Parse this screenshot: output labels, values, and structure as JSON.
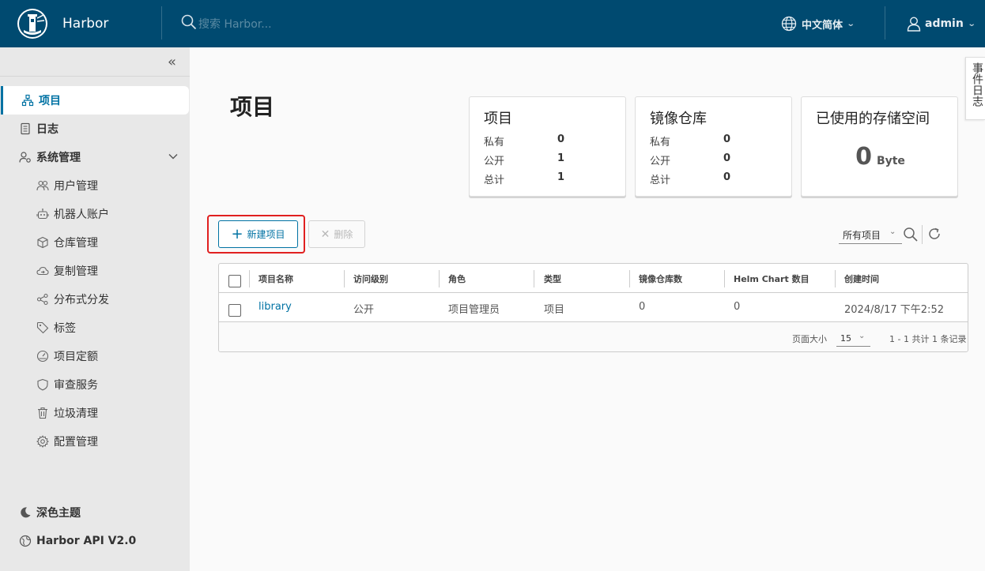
{
  "header": {
    "app_name": "Harbor",
    "search_placeholder": "搜索 Harbor...",
    "language": "中文简体",
    "user": "admin"
  },
  "sidebar": {
    "items": [
      {
        "label": "项目",
        "icon": "projects-icon",
        "active": true
      },
      {
        "label": "日志",
        "icon": "logs-icon"
      },
      {
        "label": "系统管理",
        "icon": "admin-settings-icon",
        "expanded": true
      },
      {
        "label": "用户管理",
        "icon": "users-icon"
      },
      {
        "label": "机器人账户",
        "icon": "robot-icon"
      },
      {
        "label": "仓库管理",
        "icon": "registry-icon"
      },
      {
        "label": "复制管理",
        "icon": "cloud-replication-icon"
      },
      {
        "label": "分布式分发",
        "icon": "share-icon"
      },
      {
        "label": "标签",
        "icon": "tag-icon"
      },
      {
        "label": "项目定额",
        "icon": "quota-gauge-icon"
      },
      {
        "label": "审查服务",
        "icon": "shield-icon"
      },
      {
        "label": "垃圾清理",
        "icon": "trash-icon"
      },
      {
        "label": "配置管理",
        "icon": "gear-icon"
      }
    ],
    "dark_theme": "深色主题",
    "api": "Harbor API V2.0"
  },
  "page": {
    "title": "项目"
  },
  "summary": {
    "projects": {
      "title": "项目",
      "rows": [
        {
          "label": "私有",
          "value": "0"
        },
        {
          "label": "公开",
          "value": "1"
        },
        {
          "label": "总计",
          "value": "1"
        }
      ]
    },
    "repos": {
      "title": "镜像仓库",
      "rows": [
        {
          "label": "私有",
          "value": "0"
        },
        {
          "label": "公开",
          "value": "0"
        },
        {
          "label": "总计",
          "value": "0"
        }
      ]
    },
    "storage": {
      "title": "已使用的存储空间",
      "value": "0",
      "unit": "Byte"
    }
  },
  "event_tab": "事件日志",
  "toolbar": {
    "new_project": "新建项目",
    "delete": "删除",
    "filter": "所有项目"
  },
  "table": {
    "columns": [
      "项目名称",
      "访问级别",
      "角色",
      "类型",
      "镜像仓库数",
      "Helm Chart 数目",
      "创建时间"
    ],
    "rows": [
      {
        "name": "library",
        "access": "公开",
        "role": "项目管理员",
        "type": "项目",
        "repos": "0",
        "charts": "0",
        "created": "2024/8/17 下午2:52"
      }
    ],
    "footer": {
      "page_size_label": "页面大小",
      "page_size": "15",
      "total": "1 - 1 共计 1 条记录"
    }
  },
  "colors": {
    "header": "#004a70",
    "accent": "#0072a3",
    "highlight": "#e02020"
  }
}
